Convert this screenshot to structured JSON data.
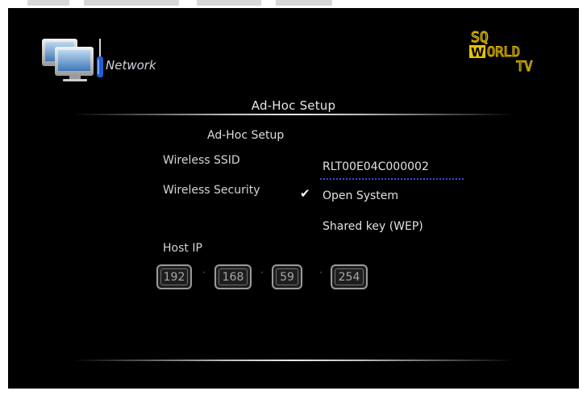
{
  "header": {
    "section_label": "Network",
    "logo": {
      "line1": "SQ",
      "line2": "WORLD",
      "line3": "TV"
    },
    "icons": [
      "network-computer-icon",
      "screwdriver-icon"
    ]
  },
  "page": {
    "title": "Ad-Hoc Setup",
    "subtitle": "Ad-Hoc Setup"
  },
  "form": {
    "ssid_label": "Wireless SSID",
    "ssid_value": "RLT00E04C000002",
    "security_label": "Wireless Security",
    "security_options": [
      {
        "label": "Open System",
        "selected": true
      },
      {
        "label": "Shared key (WEP)",
        "selected": false
      }
    ],
    "check_glyph": "✔",
    "host_ip_label": "Host IP",
    "host_ip": [
      "192",
      "168",
      "59",
      "254"
    ]
  },
  "colors": {
    "background": "#000000",
    "text": "#d4d4d4",
    "ssid_underline": "#3a4fd8",
    "logo_yellow": "#e8c200"
  }
}
